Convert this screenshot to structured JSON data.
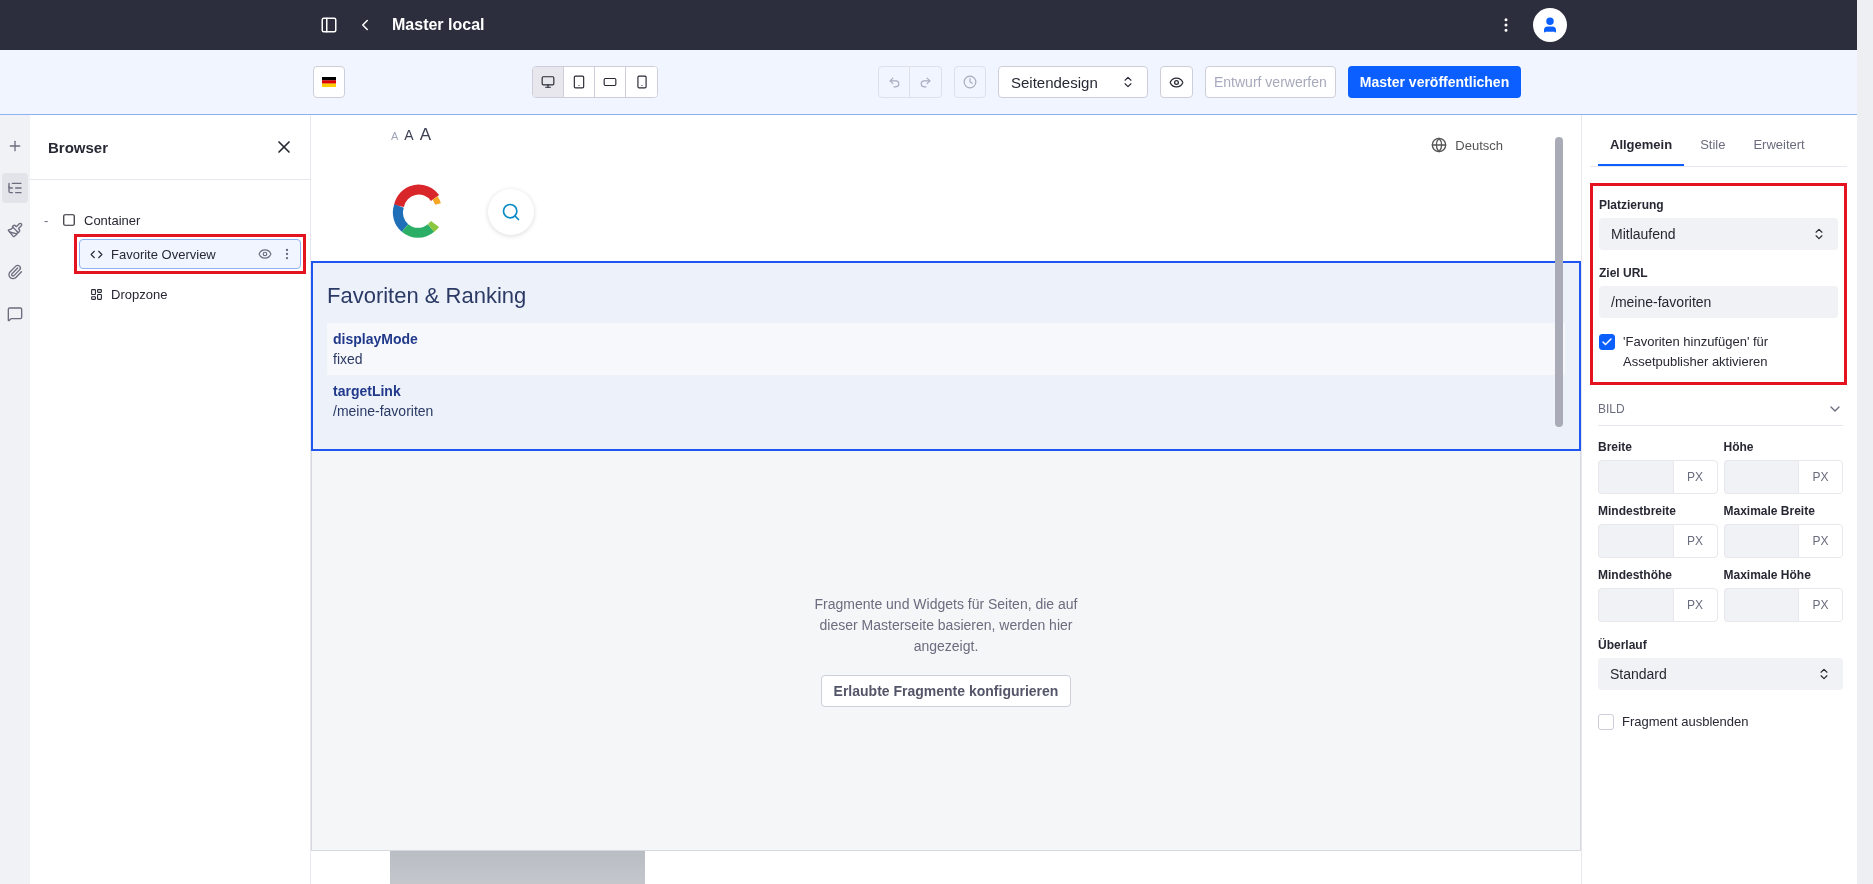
{
  "topbar": {
    "title": "Master local"
  },
  "toolbar": {
    "devices": [
      {
        "kind": "desktop",
        "selected": true
      },
      {
        "kind": "tablet",
        "selected": false
      },
      {
        "kind": "landscape",
        "selected": false
      },
      {
        "kind": "phone",
        "selected": false
      }
    ],
    "style_select": "Seitendesign",
    "discard_button": {
      "label": "Entwurf verwerfen",
      "disabled": true
    },
    "publish_button": "Master veröffentlichen"
  },
  "rail": [
    {
      "kind": "add",
      "selected": false
    },
    {
      "kind": "tree",
      "selected": true
    },
    {
      "kind": "brush",
      "selected": false
    },
    {
      "kind": "clip",
      "selected": false
    },
    {
      "kind": "comment",
      "selected": false
    }
  ],
  "browser": {
    "title": "Browser",
    "tree": [
      {
        "label": "Container",
        "kind": "container",
        "toggle": "-",
        "children": [
          {
            "label": "Favorite Overview",
            "kind": "fragment",
            "selected": true
          },
          {
            "label": "Dropzone",
            "kind": "dropzone",
            "selected": false
          }
        ]
      }
    ]
  },
  "canvas": {
    "font_sizes": [
      "A",
      "A",
      "A"
    ],
    "language": "Deutsch",
    "fragment": {
      "title": "Favoriten & Ranking",
      "fields": [
        {
          "name": "displayMode",
          "value": "fixed"
        },
        {
          "name": "targetLink",
          "value": "/meine-favoriten"
        }
      ]
    },
    "dropzone": {
      "message": "Fragmente und Widgets für Seiten, die auf dieser Masterseite basieren, werden hier angezeigt.",
      "button": "Erlaubte Fragmente konfigurieren"
    }
  },
  "settings": {
    "tabs": [
      {
        "label": "Allgemein",
        "selected": true
      },
      {
        "label": "Stile",
        "selected": false
      },
      {
        "label": "Erweitert",
        "selected": false
      }
    ],
    "placement": {
      "label": "Platzierung",
      "value": "Mitlaufend"
    },
    "target_url": {
      "label": "Ziel URL",
      "value": "/meine-favoriten"
    },
    "enable_checkbox": {
      "label": "'Favoriten hinzufügen' für Assetpublisher aktivieren",
      "checked": true
    },
    "section": {
      "title": "BILD",
      "expanded": true
    },
    "size_fields": [
      {
        "label": "Breite",
        "unit": "PX"
      },
      {
        "label": "Höhe",
        "unit": "PX"
      },
      {
        "label": "Mindestbreite",
        "unit": "PX"
      },
      {
        "label": "Maximale Breite",
        "unit": "PX"
      },
      {
        "label": "Mindesthöhe",
        "unit": "PX"
      },
      {
        "label": "Maximale Höhe",
        "unit": "PX"
      }
    ],
    "overflow": {
      "label": "Überlauf",
      "value": "Standard"
    },
    "hide_checkbox": {
      "label": "Fragment ausblenden",
      "checked": false
    }
  }
}
